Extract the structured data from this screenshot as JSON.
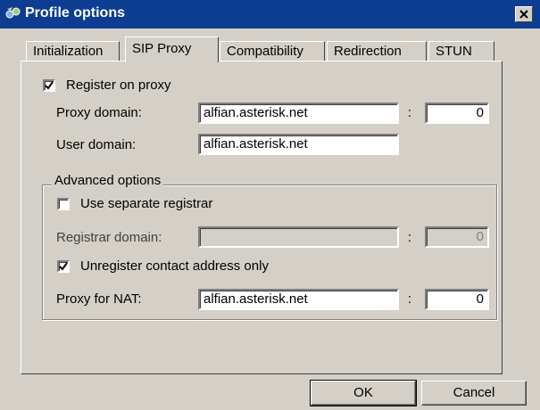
{
  "window": {
    "title": "Profile options",
    "close_icon": "close-icon",
    "app_icon": "network-icon"
  },
  "tabs": [
    {
      "label": "Initialization",
      "active": false
    },
    {
      "label": "SIP Proxy",
      "active": true
    },
    {
      "label": "Compatibility",
      "active": false
    },
    {
      "label": "Redirection",
      "active": false
    },
    {
      "label": "STUN",
      "active": false
    }
  ],
  "sip_proxy": {
    "register_on_proxy": {
      "label": "Register on proxy",
      "checked": true
    },
    "proxy_domain": {
      "label": "Proxy domain:",
      "value": "alfian.asterisk.net",
      "port": "0"
    },
    "user_domain": {
      "label": "User domain:",
      "value": "alfian.asterisk.net"
    },
    "advanced": {
      "title": "Advanced options",
      "use_separate_registrar": {
        "label": "Use separate registrar",
        "checked": false
      },
      "registrar_domain": {
        "label": "Registrar domain:",
        "value": "",
        "port": "0",
        "enabled": false
      },
      "unregister_contact_only": {
        "label": "Unregister contact address only",
        "checked": true
      },
      "proxy_for_nat": {
        "label": "Proxy for NAT:",
        "value": "alfian.asterisk.net",
        "port": "0"
      }
    },
    "colon": ":"
  },
  "buttons": {
    "ok": "OK",
    "cancel": "Cancel"
  }
}
